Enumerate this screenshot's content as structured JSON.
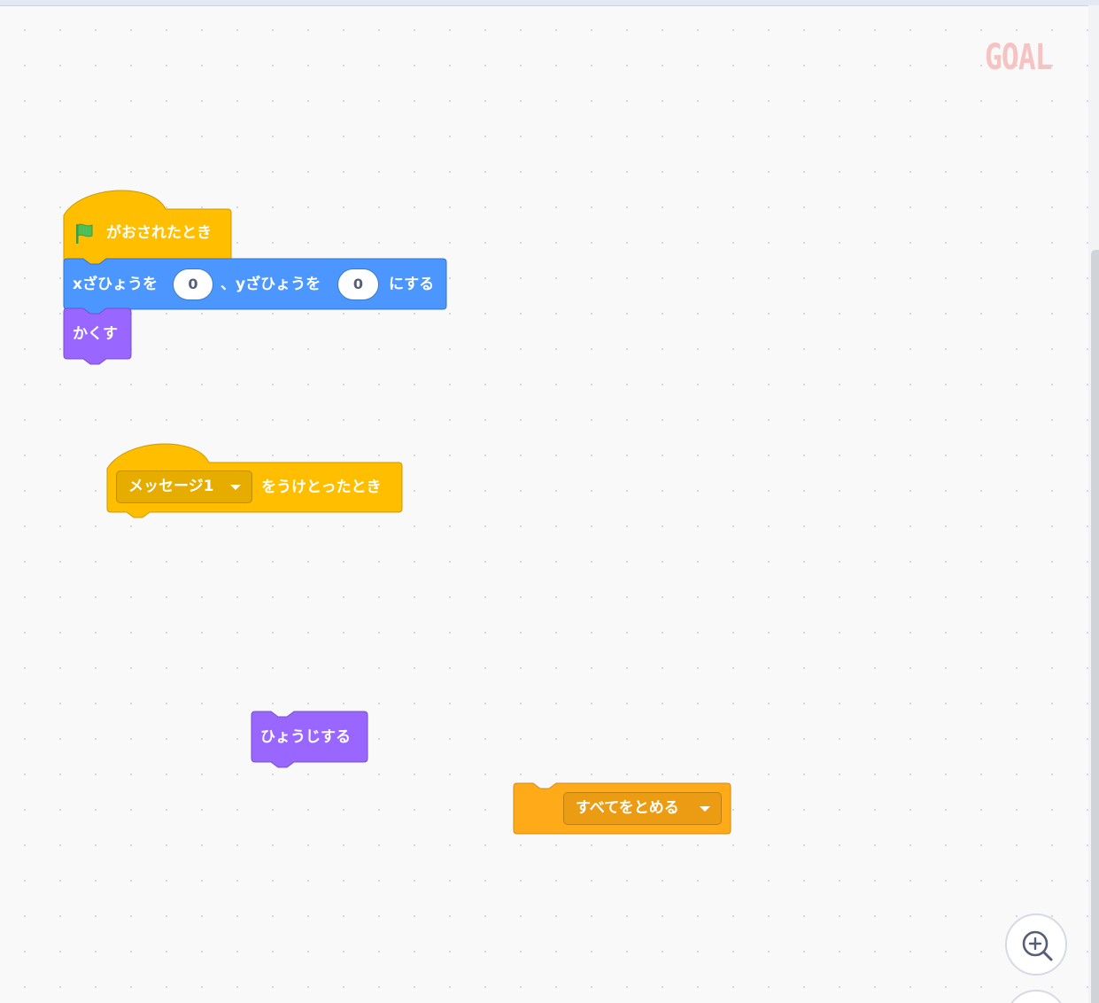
{
  "workspace": {
    "goal_label": "GOAL"
  },
  "scripts": {
    "flag_hat": {
      "label": "がおされたとき",
      "color": "#ffbf00",
      "icon": "green-flag-icon"
    },
    "goto_xy": {
      "label_x": "xざひょうを",
      "x_value": "0",
      "label_sep": "、yざひょうを",
      "y_value": "0",
      "label_end": "にする",
      "color": "#4c97ff"
    },
    "hide": {
      "label": "かくす",
      "color": "#9966ff"
    },
    "broadcast_hat": {
      "message_option": "メッセージ1",
      "label": "をうけとったとき",
      "color": "#ffbf00"
    },
    "show": {
      "label": "ひょうじする",
      "color": "#9966ff"
    },
    "stop": {
      "option": "すべてをとめる",
      "color": "#ffab19"
    }
  },
  "controls": {
    "zoom_in_icon": "zoom-in-icon"
  }
}
